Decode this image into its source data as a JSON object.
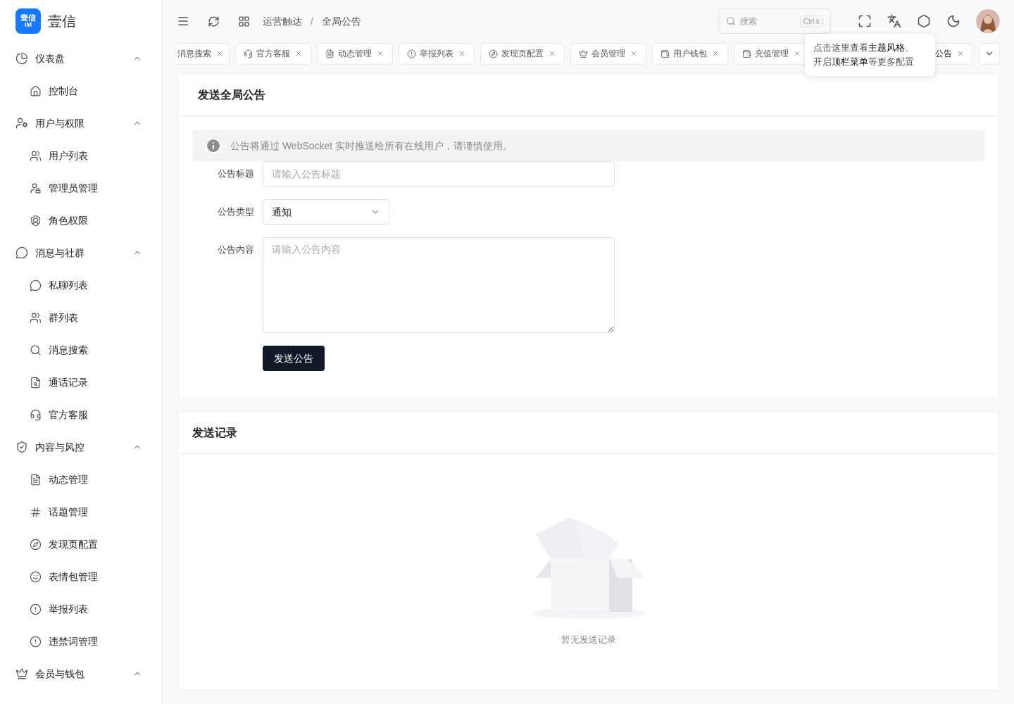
{
  "brand": {
    "logo_text": "壹信",
    "logo_sub": "IM",
    "name": "壹信"
  },
  "sidebar": {
    "groups": [
      {
        "label": "仪表盘",
        "expanded": true,
        "children": [
          {
            "label": "控制台"
          }
        ]
      },
      {
        "label": "用户与权限",
        "expanded": true,
        "children": [
          {
            "label": "用户列表"
          },
          {
            "label": "管理员管理"
          },
          {
            "label": "角色权限"
          }
        ]
      },
      {
        "label": "消息与社群",
        "expanded": true,
        "children": [
          {
            "label": "私聊列表"
          },
          {
            "label": "群列表"
          },
          {
            "label": "消息搜索"
          },
          {
            "label": "通话记录"
          },
          {
            "label": "官方客服"
          }
        ]
      },
      {
        "label": "内容与风控",
        "expanded": true,
        "children": [
          {
            "label": "动态管理"
          },
          {
            "label": "话题管理"
          },
          {
            "label": "发现页配置"
          },
          {
            "label": "表情包管理"
          },
          {
            "label": "举报列表"
          },
          {
            "label": "违禁词管理"
          }
        ]
      },
      {
        "label": "会员与钱包",
        "expanded": true
      }
    ]
  },
  "breadcrumb": [
    "运营触达",
    "全局公告"
  ],
  "breadcrumb_separator": "/",
  "search": {
    "placeholder": "搜索",
    "shortcut": "Ctrl k"
  },
  "tabs": [
    {
      "label": "消息搜索",
      "selected": false
    },
    {
      "label": "官方客服",
      "selected": false
    },
    {
      "label": "动态管理",
      "selected": false
    },
    {
      "label": "举报列表",
      "selected": false
    },
    {
      "label": "发现页配置",
      "selected": false
    },
    {
      "label": "会员管理",
      "selected": false
    },
    {
      "label": "用户钱包",
      "selected": false
    },
    {
      "label": "充值管理",
      "selected": false
    },
    {
      "label": "公告",
      "selected": true
    }
  ],
  "tooltip": "点击这里查看**主题风格**、开启**顶栏菜单**等更多配置",
  "form_card": {
    "title": "发送全局公告",
    "notice": "公告将通过 WebSocket 实时推送给所有在线用户，请谨慎使用。",
    "fields": [
      {
        "kind": "input",
        "label": "公告标题",
        "placeholder": "请输入公告标题"
      },
      {
        "kind": "select",
        "label": "公告类型",
        "value": "通知"
      },
      {
        "kind": "textarea",
        "label": "公告内容",
        "placeholder": "请输入公告内容"
      }
    ],
    "submit": "发送公告"
  },
  "records_card": {
    "title": "发送记录",
    "empty_text": "暂无发送记录"
  }
}
